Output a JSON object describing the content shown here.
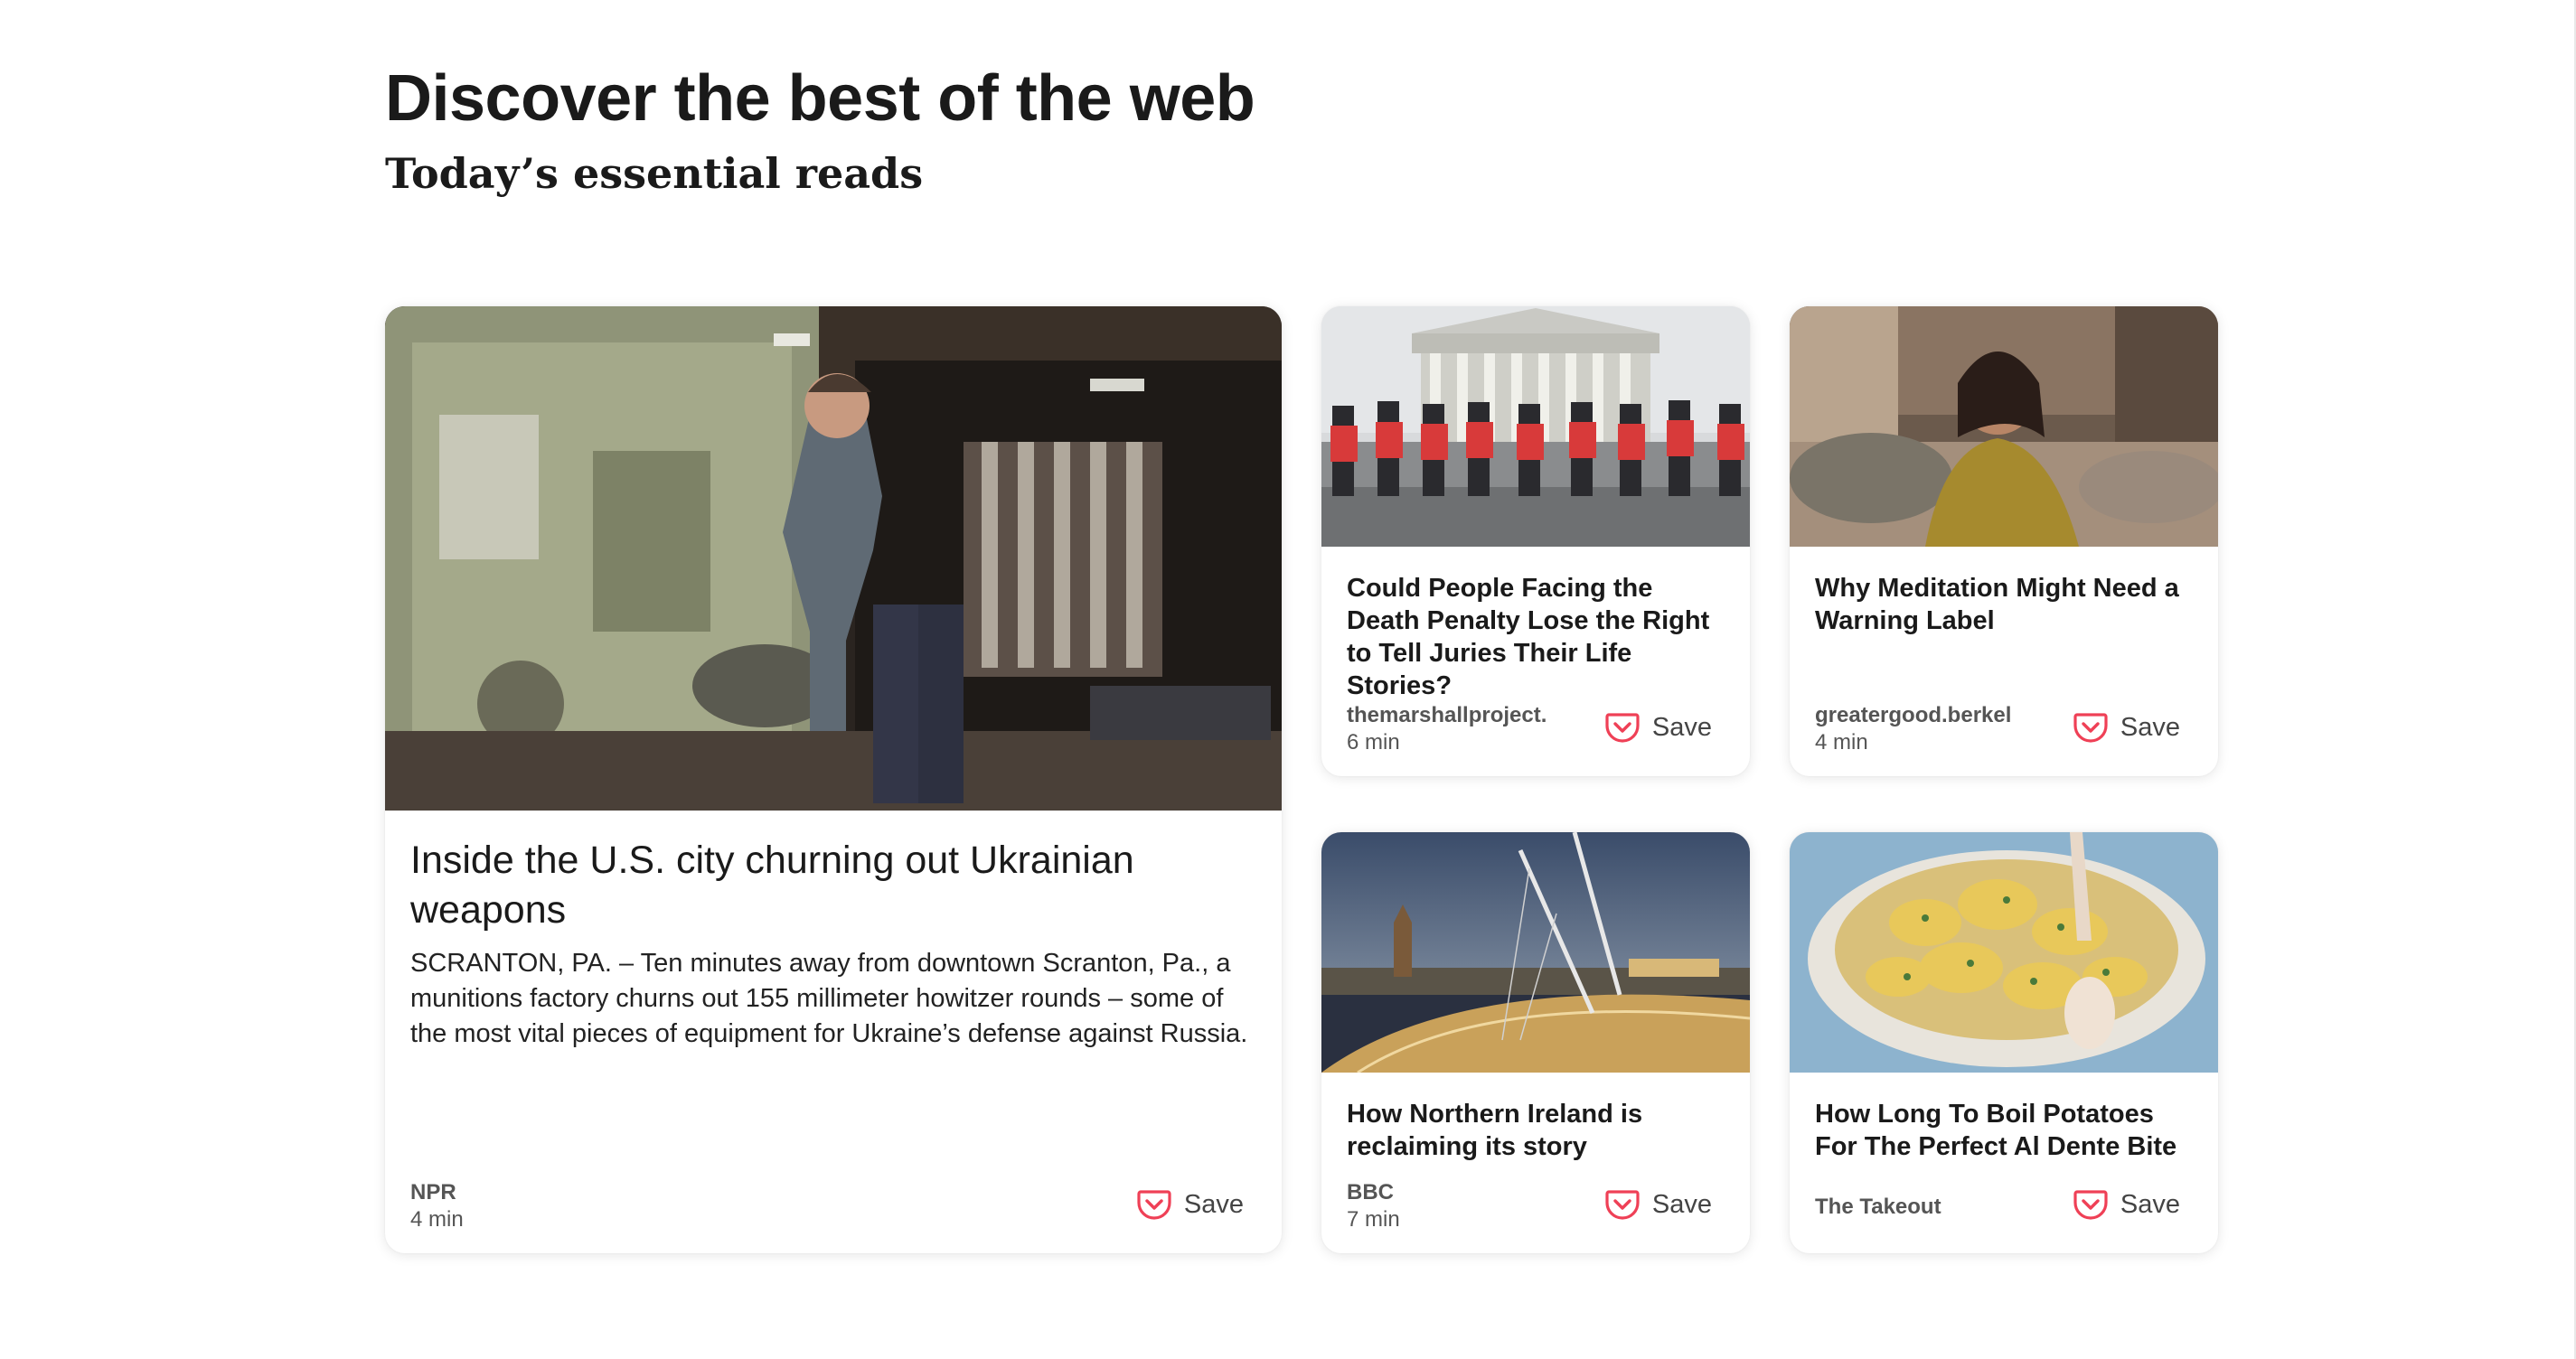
{
  "header": {
    "title": "Discover the best of the web",
    "subtitle": "Today’s essential reads"
  },
  "save_label": "Save",
  "colors": {
    "accent": "#ef4056",
    "text": "#1a1a1a",
    "meta": "#555555"
  },
  "cards": [
    {
      "title": "Inside the U.S. city churning out Ukrainian weapons",
      "excerpt": "SCRANTON, PA. – Ten minutes away from downtown Scranton, Pa., a munitions factory churns out 155 millimeter howitzer rounds – some of the most vital pieces of equipment for Ukraine’s defense against Russia.",
      "source": "NPR",
      "read_time": "4 min"
    },
    {
      "title": "Could People Facing the Death Penalty Lose the Right to Tell Juries Their Life Stories?",
      "source": "themarshallproject.",
      "read_time": "6 min"
    },
    {
      "title": "Why Meditation Might Need a Warning Label",
      "source": "greatergood.berkel",
      "read_time": "4 min"
    },
    {
      "title": "How Northern Ireland is reclaiming its story",
      "source": "BBC",
      "read_time": "7 min"
    },
    {
      "title": "How Long To Boil Potatoes For The Perfect Al Dente Bite",
      "source": "The Takeout",
      "read_time": ""
    }
  ]
}
